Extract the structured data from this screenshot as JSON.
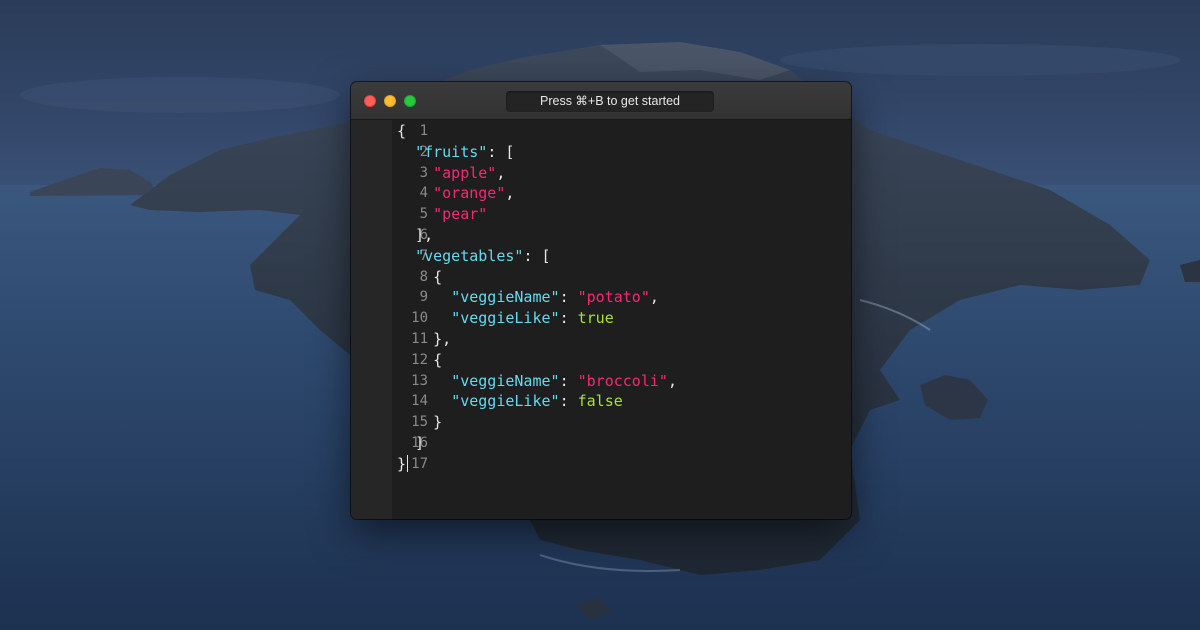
{
  "window": {
    "hint": "Press ⌘+B to get started"
  },
  "editor": {
    "line_numbers": [
      "1",
      "2",
      "3",
      "4",
      "5",
      "6",
      "7",
      "8",
      "9",
      "10",
      "11",
      "12",
      "13",
      "14",
      "15",
      "16",
      "17"
    ],
    "lines": [
      [
        {
          "t": "{",
          "c": "punct"
        }
      ],
      [
        {
          "t": "  ",
          "c": "punct"
        },
        {
          "t": "\"fruits\"",
          "c": "key"
        },
        {
          "t": ": [",
          "c": "punct"
        }
      ],
      [
        {
          "t": "    ",
          "c": "punct"
        },
        {
          "t": "\"apple\"",
          "c": "str"
        },
        {
          "t": ",",
          "c": "punct"
        }
      ],
      [
        {
          "t": "    ",
          "c": "punct"
        },
        {
          "t": "\"orange\"",
          "c": "str"
        },
        {
          "t": ",",
          "c": "punct"
        }
      ],
      [
        {
          "t": "    ",
          "c": "punct"
        },
        {
          "t": "\"pear\"",
          "c": "str"
        }
      ],
      [
        {
          "t": "  ],",
          "c": "punct"
        }
      ],
      [
        {
          "t": "  ",
          "c": "punct"
        },
        {
          "t": "\"vegetables\"",
          "c": "key"
        },
        {
          "t": ": [",
          "c": "punct"
        }
      ],
      [
        {
          "t": "    {",
          "c": "punct"
        }
      ],
      [
        {
          "t": "      ",
          "c": "punct"
        },
        {
          "t": "\"veggieName\"",
          "c": "key"
        },
        {
          "t": ": ",
          "c": "punct"
        },
        {
          "t": "\"potato\"",
          "c": "str"
        },
        {
          "t": ",",
          "c": "punct"
        }
      ],
      [
        {
          "t": "      ",
          "c": "punct"
        },
        {
          "t": "\"veggieLike\"",
          "c": "key"
        },
        {
          "t": ": ",
          "c": "punct"
        },
        {
          "t": "true",
          "c": "bool"
        }
      ],
      [
        {
          "t": "    },",
          "c": "punct"
        }
      ],
      [
        {
          "t": "    {",
          "c": "punct"
        }
      ],
      [
        {
          "t": "      ",
          "c": "punct"
        },
        {
          "t": "\"veggieName\"",
          "c": "key"
        },
        {
          "t": ": ",
          "c": "punct"
        },
        {
          "t": "\"broccoli\"",
          "c": "str"
        },
        {
          "t": ",",
          "c": "punct"
        }
      ],
      [
        {
          "t": "      ",
          "c": "punct"
        },
        {
          "t": "\"veggieLike\"",
          "c": "key"
        },
        {
          "t": ": ",
          "c": "punct"
        },
        {
          "t": "false",
          "c": "bool"
        }
      ],
      [
        {
          "t": "    }",
          "c": "punct"
        }
      ],
      [
        {
          "t": "  ]",
          "c": "punct"
        }
      ],
      [
        {
          "t": "}",
          "c": "punct"
        }
      ]
    ],
    "cursor_line": 17
  },
  "colors": {
    "key": "#66d9ef",
    "string": "#f92672",
    "boolean": "#a6e22e",
    "traffic_close": "#fe5f57",
    "traffic_minimize": "#febc2e",
    "traffic_zoom": "#28c840"
  }
}
